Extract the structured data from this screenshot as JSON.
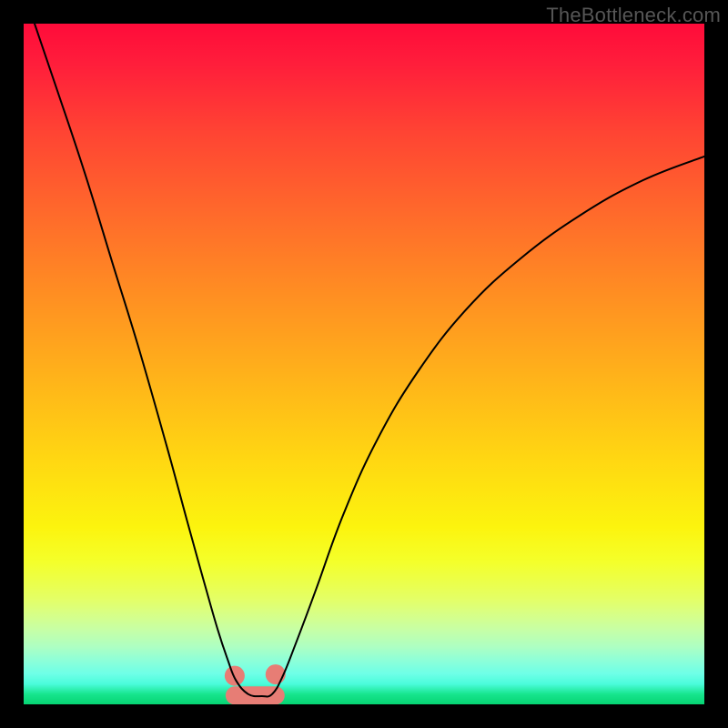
{
  "watermark": "TheBottleneck.com",
  "chart_data": {
    "type": "line",
    "title": "",
    "xlabel": "",
    "ylabel": "",
    "xlim": [
      0,
      100
    ],
    "ylim": [
      0,
      100
    ],
    "grid": false,
    "legend": false,
    "background": "red-yellow-green vertical gradient",
    "curve_approximation": [
      {
        "x": 1.6,
        "y": 100.0
      },
      {
        "x": 5.0,
        "y": 90.0
      },
      {
        "x": 9.0,
        "y": 78.0
      },
      {
        "x": 13.0,
        "y": 65.0
      },
      {
        "x": 17.0,
        "y": 52.0
      },
      {
        "x": 21.0,
        "y": 38.0
      },
      {
        "x": 24.0,
        "y": 27.0
      },
      {
        "x": 26.5,
        "y": 18.0
      },
      {
        "x": 28.5,
        "y": 11.0
      },
      {
        "x": 30.0,
        "y": 6.5
      },
      {
        "x": 31.2,
        "y": 3.5
      },
      {
        "x": 33.0,
        "y": 1.5
      },
      {
        "x": 35.0,
        "y": 1.2
      },
      {
        "x": 36.5,
        "y": 1.5
      },
      {
        "x": 38.0,
        "y": 4.0
      },
      {
        "x": 40.0,
        "y": 9.0
      },
      {
        "x": 43.0,
        "y": 17.0
      },
      {
        "x": 47.0,
        "y": 28.0
      },
      {
        "x": 52.0,
        "y": 39.0
      },
      {
        "x": 58.0,
        "y": 49.0
      },
      {
        "x": 65.0,
        "y": 58.0
      },
      {
        "x": 73.0,
        "y": 65.5
      },
      {
        "x": 82.0,
        "y": 72.0
      },
      {
        "x": 91.0,
        "y": 77.0
      },
      {
        "x": 100.0,
        "y": 80.5
      }
    ],
    "highlight_segment": {
      "x_start": 31.0,
      "x_end": 37.0,
      "y": 1.3
    },
    "highlight_dots": [
      {
        "x": 31.0,
        "y": 4.2
      },
      {
        "x": 37.0,
        "y": 4.4
      }
    ]
  }
}
